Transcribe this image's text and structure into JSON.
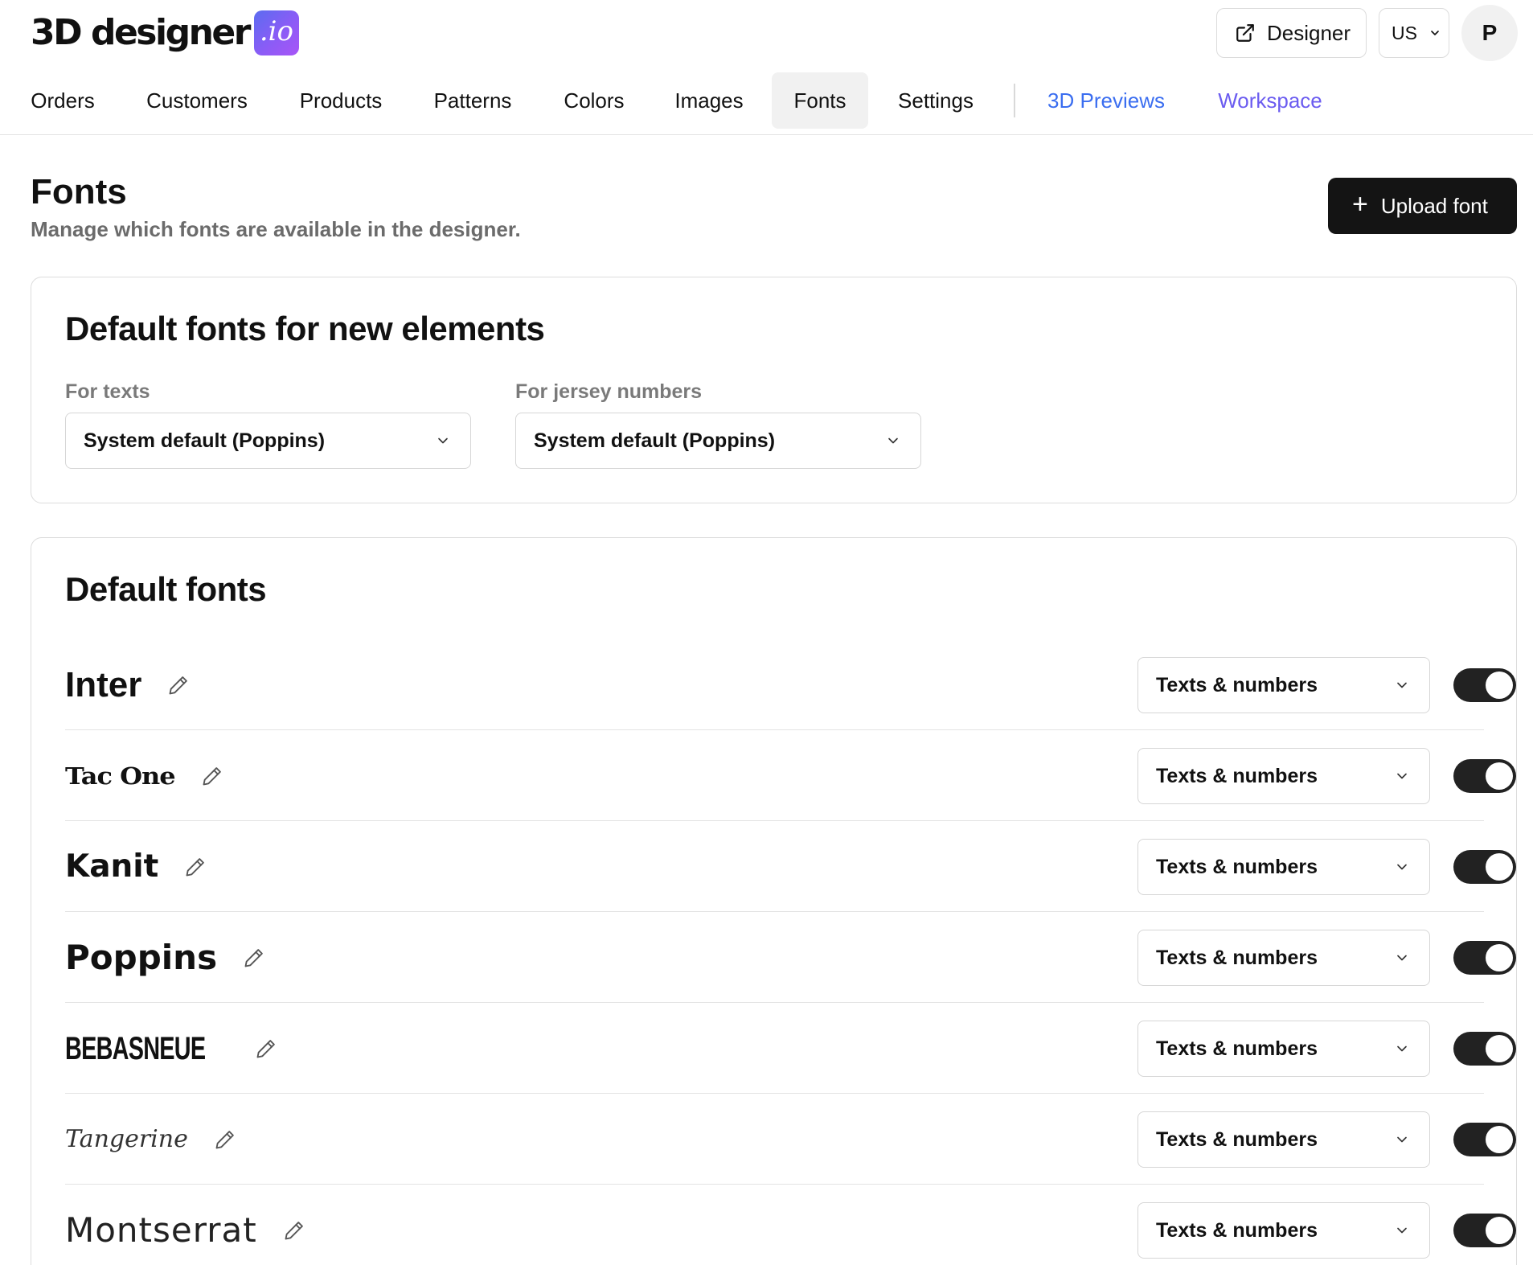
{
  "brand": {
    "name": "3D designer",
    "badge": ".io"
  },
  "header": {
    "designer_label": "Designer",
    "locale": "US",
    "avatar_initial": "P"
  },
  "nav": {
    "items": [
      {
        "label": "Orders"
      },
      {
        "label": "Customers"
      },
      {
        "label": "Products"
      },
      {
        "label": "Patterns"
      },
      {
        "label": "Colors"
      },
      {
        "label": "Images"
      },
      {
        "label": "Fonts",
        "active": true
      },
      {
        "label": "Settings"
      },
      {
        "label": "3D Previews"
      },
      {
        "label": "Workspace"
      }
    ]
  },
  "page": {
    "title": "Fonts",
    "subtitle": "Manage which fonts are available in the designer.",
    "upload_label": "Upload font"
  },
  "defaults_card": {
    "title": "Default fonts for new elements",
    "texts_label": "For texts",
    "texts_value": "System default (Poppins)",
    "jersey_label": "For jersey numbers",
    "jersey_value": "System default (Poppins)"
  },
  "fonts_card": {
    "title": "Default fonts",
    "fonts": [
      {
        "name": "Inter",
        "usage": "Texts & numbers",
        "enabled": true
      },
      {
        "name": "Tac One",
        "usage": "Texts & numbers",
        "enabled": true
      },
      {
        "name": "Kanit",
        "usage": "Texts & numbers",
        "enabled": true
      },
      {
        "name": "Poppins",
        "usage": "Texts & numbers",
        "enabled": true
      },
      {
        "name": "BEBASNEUE",
        "usage": "Texts & numbers",
        "enabled": true
      },
      {
        "name": "Tangerine",
        "usage": "Texts & numbers",
        "enabled": true
      },
      {
        "name": "Montserrat",
        "usage": "Texts & numbers",
        "enabled": true
      }
    ]
  },
  "colors": {
    "primary_button": "#141414",
    "nav_active_bg": "#f1f1f1",
    "link_blue": "#3b6ef0",
    "link_violet": "#6b5cf0",
    "toggle_on": "#222222"
  }
}
